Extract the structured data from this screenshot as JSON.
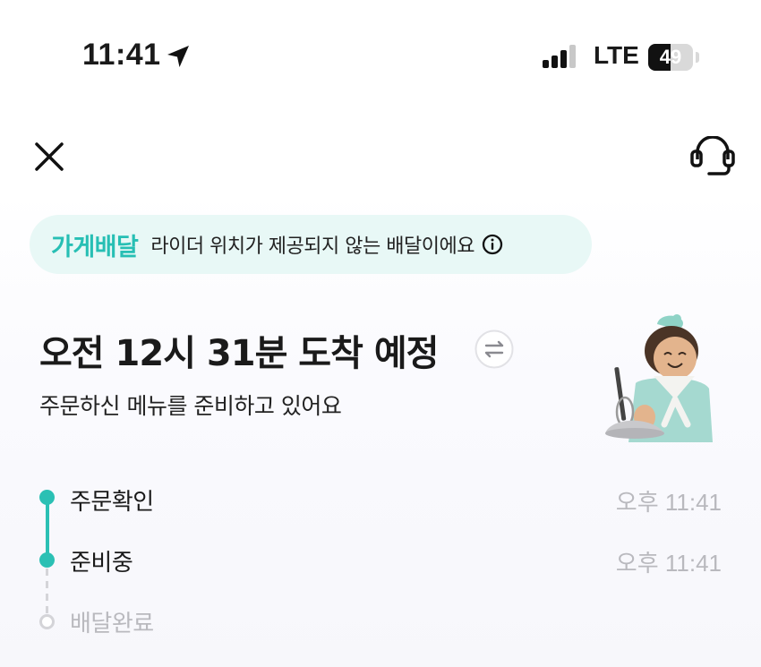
{
  "status_bar": {
    "time": "11:41",
    "network": "LTE",
    "battery": "49",
    "battery_level": 0.49
  },
  "header": {
    "close_icon": "close-icon",
    "support_icon": "headset-icon"
  },
  "notice": {
    "tag": "가게배달",
    "text": "라이더 위치가 제공되지 않는 배달이에요",
    "icon": "info-icon"
  },
  "order": {
    "eta": "오전 12시 31분 도착 예정",
    "status": "주문하신 메뉴를 준비하고 있어요"
  },
  "timeline": {
    "steps": [
      {
        "label": "주문확인",
        "time": "오후 11:41",
        "state": "done"
      },
      {
        "label": "준비중",
        "time": "오후 11:41",
        "state": "current"
      },
      {
        "label": "배달완료",
        "time": "",
        "state": "pending"
      }
    ]
  },
  "colors": {
    "accent": "#2bc0b4",
    "notice_bg": "#e8f8f6",
    "pending": "#b9b9be"
  }
}
